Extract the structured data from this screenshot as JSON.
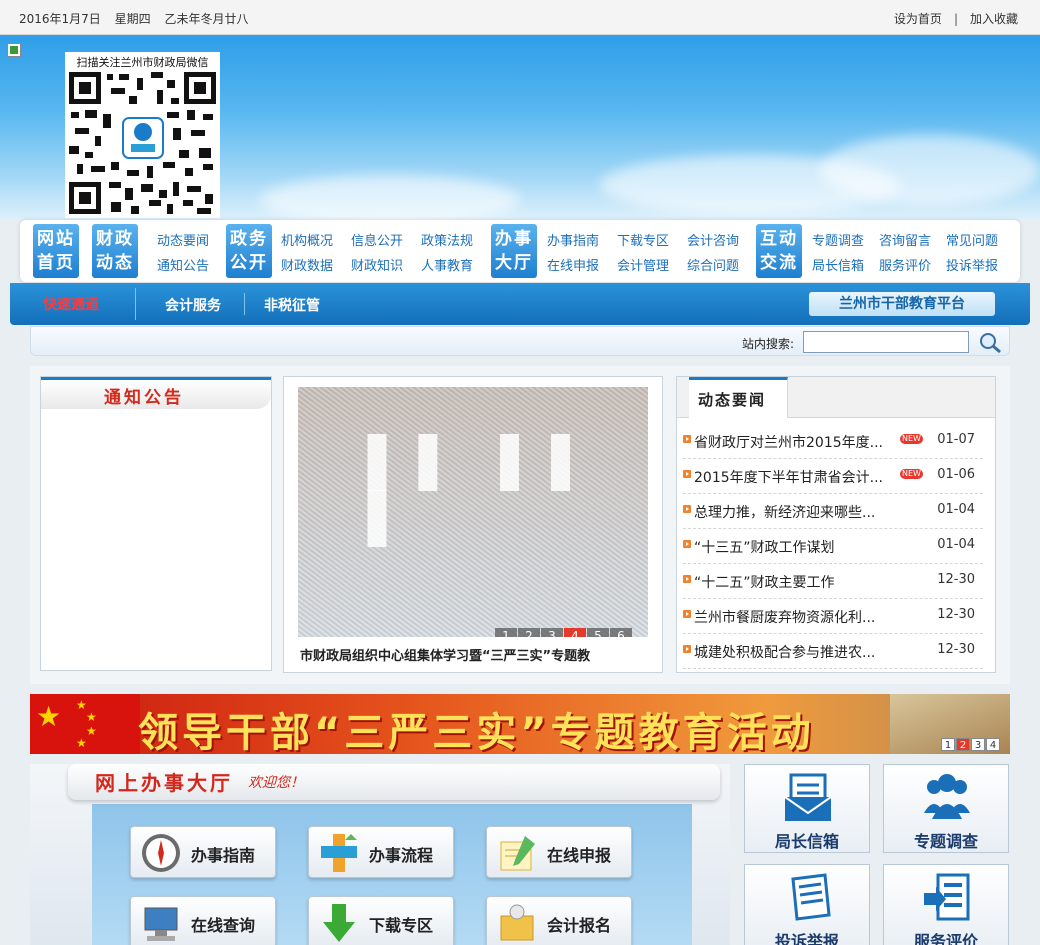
{
  "topbar": {
    "date": "2016年1月7日",
    "weekday": "星期四",
    "lunar": "乙未年冬月廿八",
    "set_home": "设为首页",
    "separator": "|",
    "add_favorite": "加入收藏"
  },
  "qr": {
    "caption": "扫描关注兰州市财政局微信"
  },
  "nav": {
    "btn1": [
      "网站",
      "首页"
    ],
    "btn2": [
      "财政",
      "动态"
    ],
    "btn3": [
      "政务",
      "公开"
    ],
    "btn4": [
      "办事",
      "大厅"
    ],
    "btn5": [
      "互动",
      "交流"
    ],
    "links": {
      "dtyw": "动态要闻",
      "tzgg": "通知公告",
      "jggk": "机构概况",
      "czsj": "财政数据",
      "xxgk": "信息公开",
      "czzs": "财政知识",
      "zcfg": "政策法规",
      "rsjy": "人事教育",
      "bszn": "办事指南",
      "zxsb": "在线申报",
      "xzzq": "下载专区",
      "kjgl": "会计管理",
      "kjzx": "会计咨询",
      "zhwt": "综合问题",
      "ztdc": "专题调查",
      "jzxx": "局长信箱",
      "zxly": "咨询留言",
      "fwpj": "服务评价",
      "cjwt": "常见问题",
      "tsjb": "投诉举报"
    }
  },
  "quickbar": {
    "fast": "快速通道",
    "link1": "会计服务",
    "link2": "非税征管",
    "cadre": "兰州市干部教育平台"
  },
  "search": {
    "label": "站内搜索:",
    "placeholder": ""
  },
  "notice": {
    "title": "通知公告"
  },
  "slider": {
    "caption": "市财政局组织中心组集体学习暨“三严三实”专题教",
    "pages": [
      "1",
      "2",
      "3",
      "4",
      "5",
      "6"
    ],
    "active": "4"
  },
  "news": {
    "tab": "动态要闻",
    "items": [
      {
        "title": "省财政厅对兰州市2015年度...",
        "date": "01-07",
        "new": "NEW"
      },
      {
        "title": "2015年度下半年甘肃省会计...",
        "date": "01-06",
        "new": "NEW"
      },
      {
        "title": "总理力推，新经济迎来哪些...",
        "date": "01-04"
      },
      {
        "title": "“十三五”财政工作谋划",
        "date": "01-04"
      },
      {
        "title": "“十二五”财政主要工作",
        "date": "12-30"
      },
      {
        "title": "兰州市餐厨废弃物资源化利...",
        "date": "12-30"
      },
      {
        "title": "城建处积极配合参与推进农...",
        "date": "12-30"
      }
    ]
  },
  "banner": {
    "title": "领导干部“三严三实”专题教育活动",
    "pages": [
      "1",
      "2",
      "3",
      "4"
    ],
    "active": "2"
  },
  "hall": {
    "title": "网上办事大厅",
    "welcome": "欢迎您！",
    "services": {
      "bszn": "办事指南",
      "bslc": "办事流程",
      "zxsb": "在线申报",
      "zxcx": "在线查询",
      "xzzq": "下载专区",
      "kjbm": "会计报名"
    }
  },
  "quick_boxes": {
    "jzxx": "局长信箱",
    "ztdc": "专题调查",
    "tsjb": "投诉举报",
    "fwpj": "服务评价"
  },
  "colors": {
    "brand_blue": "#1a7cc8",
    "accent_red": "#d42a1d",
    "orange": "#f0822b"
  },
  "icons": [
    "search-icon",
    "compass-icon",
    "flow-icon",
    "pen-icon",
    "computer-icon",
    "download-arrow-icon",
    "scroll-icon",
    "mail-icon",
    "people-icon",
    "document-icon",
    "form-icon",
    "qr-code-icon"
  ]
}
